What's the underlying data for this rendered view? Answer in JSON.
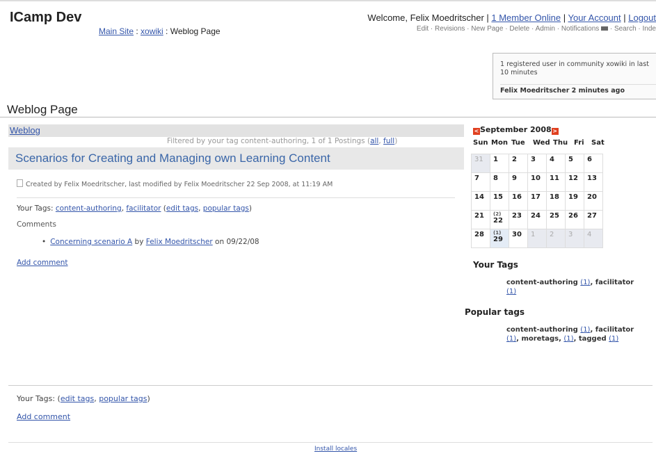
{
  "header": {
    "site_title": "ICamp Dev",
    "breadcrumb": {
      "main_site": "Main Site",
      "sep1": " : ",
      "xowiki": "xowiki",
      "sep2": " : ",
      "current": "Weblog Page"
    },
    "welcome": {
      "prefix": "Welcome, Felix Moedritscher | ",
      "members_online": "1 Member Online",
      "sep1": " | ",
      "your_account": "Your Account",
      "sep2": " | ",
      "logout": "Logout"
    },
    "toolbar": {
      "edit": "Edit",
      "revisions": "Revisions",
      "new_page": "New Page",
      "delete": "Delete",
      "admin": "Admin",
      "notifications": "Notifications",
      "search": "Search",
      "index": "Inde",
      "sep": " · "
    }
  },
  "online_box": {
    "text": "1 registered user in community xowiki in last 10 minutes",
    "user": "Felix Moedritscher 2 minutes ago"
  },
  "page_title": "Weblog Page",
  "weblog": {
    "link": "Weblog",
    "filter_prefix": "Filtered by your tag content-authoring, 1 of 1 Postings (",
    "filter_all": "all",
    "filter_sep": ", ",
    "filter_full": "full",
    "filter_suffix": ")"
  },
  "post": {
    "title": "Scenarios for Creating and Managing own Learning Content",
    "meta": "Created by Felix Moedritscher, last modified by Felix Moedritscher 22 Sep 2008, at 11:19 AM",
    "tags_label": "Your Tags: ",
    "tag1": "content-authoring",
    "tag2": "facilitator",
    "edit_tags": "edit tags",
    "popular_tags": "popular tags",
    "comments_label": "Comments",
    "comment_link": "Concerning scenario A",
    "comment_by": " by ",
    "comment_author": "Felix Moedritscher",
    "comment_date": " on 09/22/08",
    "add_comment": "Add comment"
  },
  "footer": {
    "tags_label": "Your Tags: (",
    "edit_tags": "edit tags",
    "sep": ", ",
    "popular_tags": "popular tags",
    "close": ")",
    "add_comment": "Add comment",
    "install_locales": "Install locales"
  },
  "calendar": {
    "month": "September 2008",
    "prev": "<",
    "next": ">",
    "days": [
      "Sun",
      "Mon",
      "Tue",
      "Wed",
      "Thu",
      "Fri",
      "Sat"
    ],
    "weeks": [
      [
        {
          "d": "31",
          "out": true
        },
        {
          "d": "1"
        },
        {
          "d": "2"
        },
        {
          "d": "3"
        },
        {
          "d": "4"
        },
        {
          "d": "5"
        },
        {
          "d": "6"
        }
      ],
      [
        {
          "d": "7"
        },
        {
          "d": "8"
        },
        {
          "d": "9"
        },
        {
          "d": "10"
        },
        {
          "d": "11"
        },
        {
          "d": "12"
        },
        {
          "d": "13"
        }
      ],
      [
        {
          "d": "14"
        },
        {
          "d": "15"
        },
        {
          "d": "16"
        },
        {
          "d": "17"
        },
        {
          "d": "18"
        },
        {
          "d": "19"
        },
        {
          "d": "20"
        }
      ],
      [
        {
          "d": "21"
        },
        {
          "d": "22",
          "ev": "(2)"
        },
        {
          "d": "23"
        },
        {
          "d": "24"
        },
        {
          "d": "25"
        },
        {
          "d": "26"
        },
        {
          "d": "27"
        }
      ],
      [
        {
          "d": "28"
        },
        {
          "d": "29",
          "ev": "(1)",
          "today": true
        },
        {
          "d": "30"
        },
        {
          "d": "1",
          "out": true
        },
        {
          "d": "2",
          "out": true
        },
        {
          "d": "3",
          "out": true
        },
        {
          "d": "4",
          "out": true
        }
      ]
    ]
  },
  "sidebar": {
    "your_tags_head": "Your Tags",
    "your_tags": [
      {
        "name": "content-authoring",
        "count": "(1)",
        "sep": ","
      },
      {
        "name": "facilitator",
        "count": "(1)",
        "sep": ""
      }
    ],
    "popular_head": "Popular tags",
    "popular_tags": [
      {
        "name": "content-authoring",
        "count": "(1)",
        "sep": ","
      },
      {
        "name": "facilitator",
        "count": "(1)",
        "sep": ","
      },
      {
        "name": "moretags,",
        "count": "(1)",
        "sep": ","
      },
      {
        "name": "tagged",
        "count": "(1)",
        "sep": ""
      }
    ]
  },
  "colors": {
    "link": "#3355aa",
    "title_bar": "#e8e8e8",
    "nav_icon": "#e04020"
  }
}
